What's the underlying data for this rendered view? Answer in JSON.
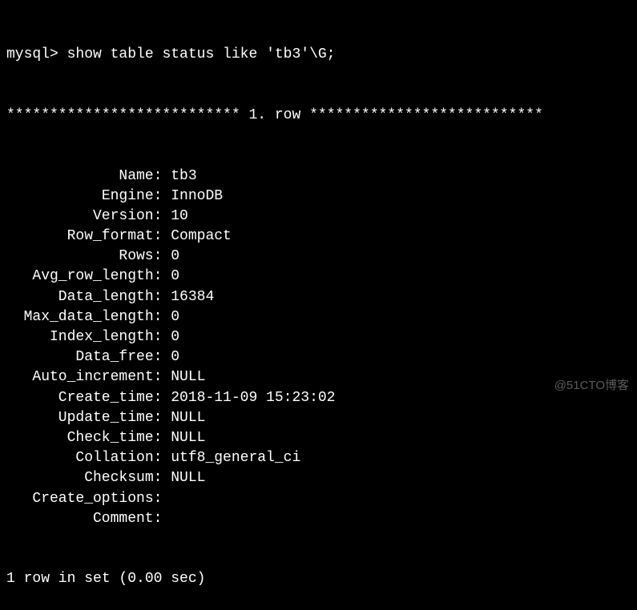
{
  "prompt": {
    "prefix": "mysql>",
    "command": "show table status like 'tb3'\\G;"
  },
  "row_header": {
    "stars_left": "***************************",
    "label": "1. row",
    "stars_right": "***************************"
  },
  "fields": [
    {
      "label": "Name",
      "value": "tb3"
    },
    {
      "label": "Engine",
      "value": "InnoDB"
    },
    {
      "label": "Version",
      "value": "10"
    },
    {
      "label": "Row_format",
      "value": "Compact"
    },
    {
      "label": "Rows",
      "value": "0"
    },
    {
      "label": "Avg_row_length",
      "value": "0"
    },
    {
      "label": "Data_length",
      "value": "16384"
    },
    {
      "label": "Max_data_length",
      "value": "0"
    },
    {
      "label": "Index_length",
      "value": "0"
    },
    {
      "label": "Data_free",
      "value": "0"
    },
    {
      "label": "Auto_increment",
      "value": "NULL"
    },
    {
      "label": "Create_time",
      "value": "2018-11-09 15:23:02"
    },
    {
      "label": "Update_time",
      "value": "NULL"
    },
    {
      "label": "Check_time",
      "value": "NULL"
    },
    {
      "label": "Collation",
      "value": "utf8_general_ci"
    },
    {
      "label": "Checksum",
      "value": "NULL"
    },
    {
      "label": "Create_options",
      "value": ""
    },
    {
      "label": "Comment",
      "value": ""
    }
  ],
  "footer": "1 row in set (0.00 sec)",
  "watermark": "@51CTO博客"
}
